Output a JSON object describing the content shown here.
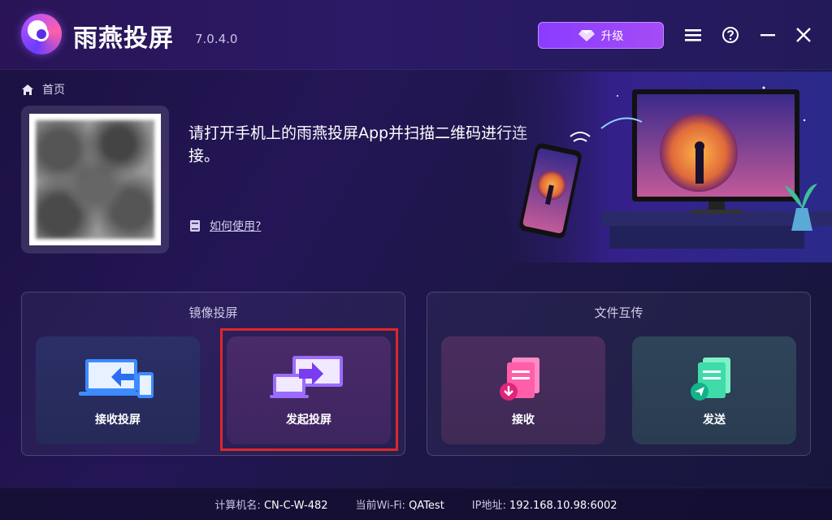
{
  "app": {
    "title": "雨燕投屏",
    "version": "7.0.4.0"
  },
  "toolbar": {
    "upgrade_label": "升级"
  },
  "breadcrumb": {
    "home": "首页"
  },
  "connect": {
    "instruction": "请打开手机上的雨燕投屏App并扫描二维码进行连接。",
    "howto_label": "如何使用?"
  },
  "mirror_section": {
    "title": "镜像投屏",
    "receive_label": "接收投屏",
    "send_label": "发起投屏"
  },
  "file_section": {
    "title": "文件互传",
    "receive_label": "接收",
    "send_label": "发送"
  },
  "footer": {
    "computer_label": "计算机名:",
    "computer_value": "CN-C-W-482",
    "wifi_label": "当前Wi-Fi:",
    "wifi_value": "QATest",
    "ip_label": "IP地址:",
    "ip_value": "192.168.10.98:6002"
  },
  "colors": {
    "accent": "#8a3cff",
    "highlight_border": "#e0262a"
  }
}
